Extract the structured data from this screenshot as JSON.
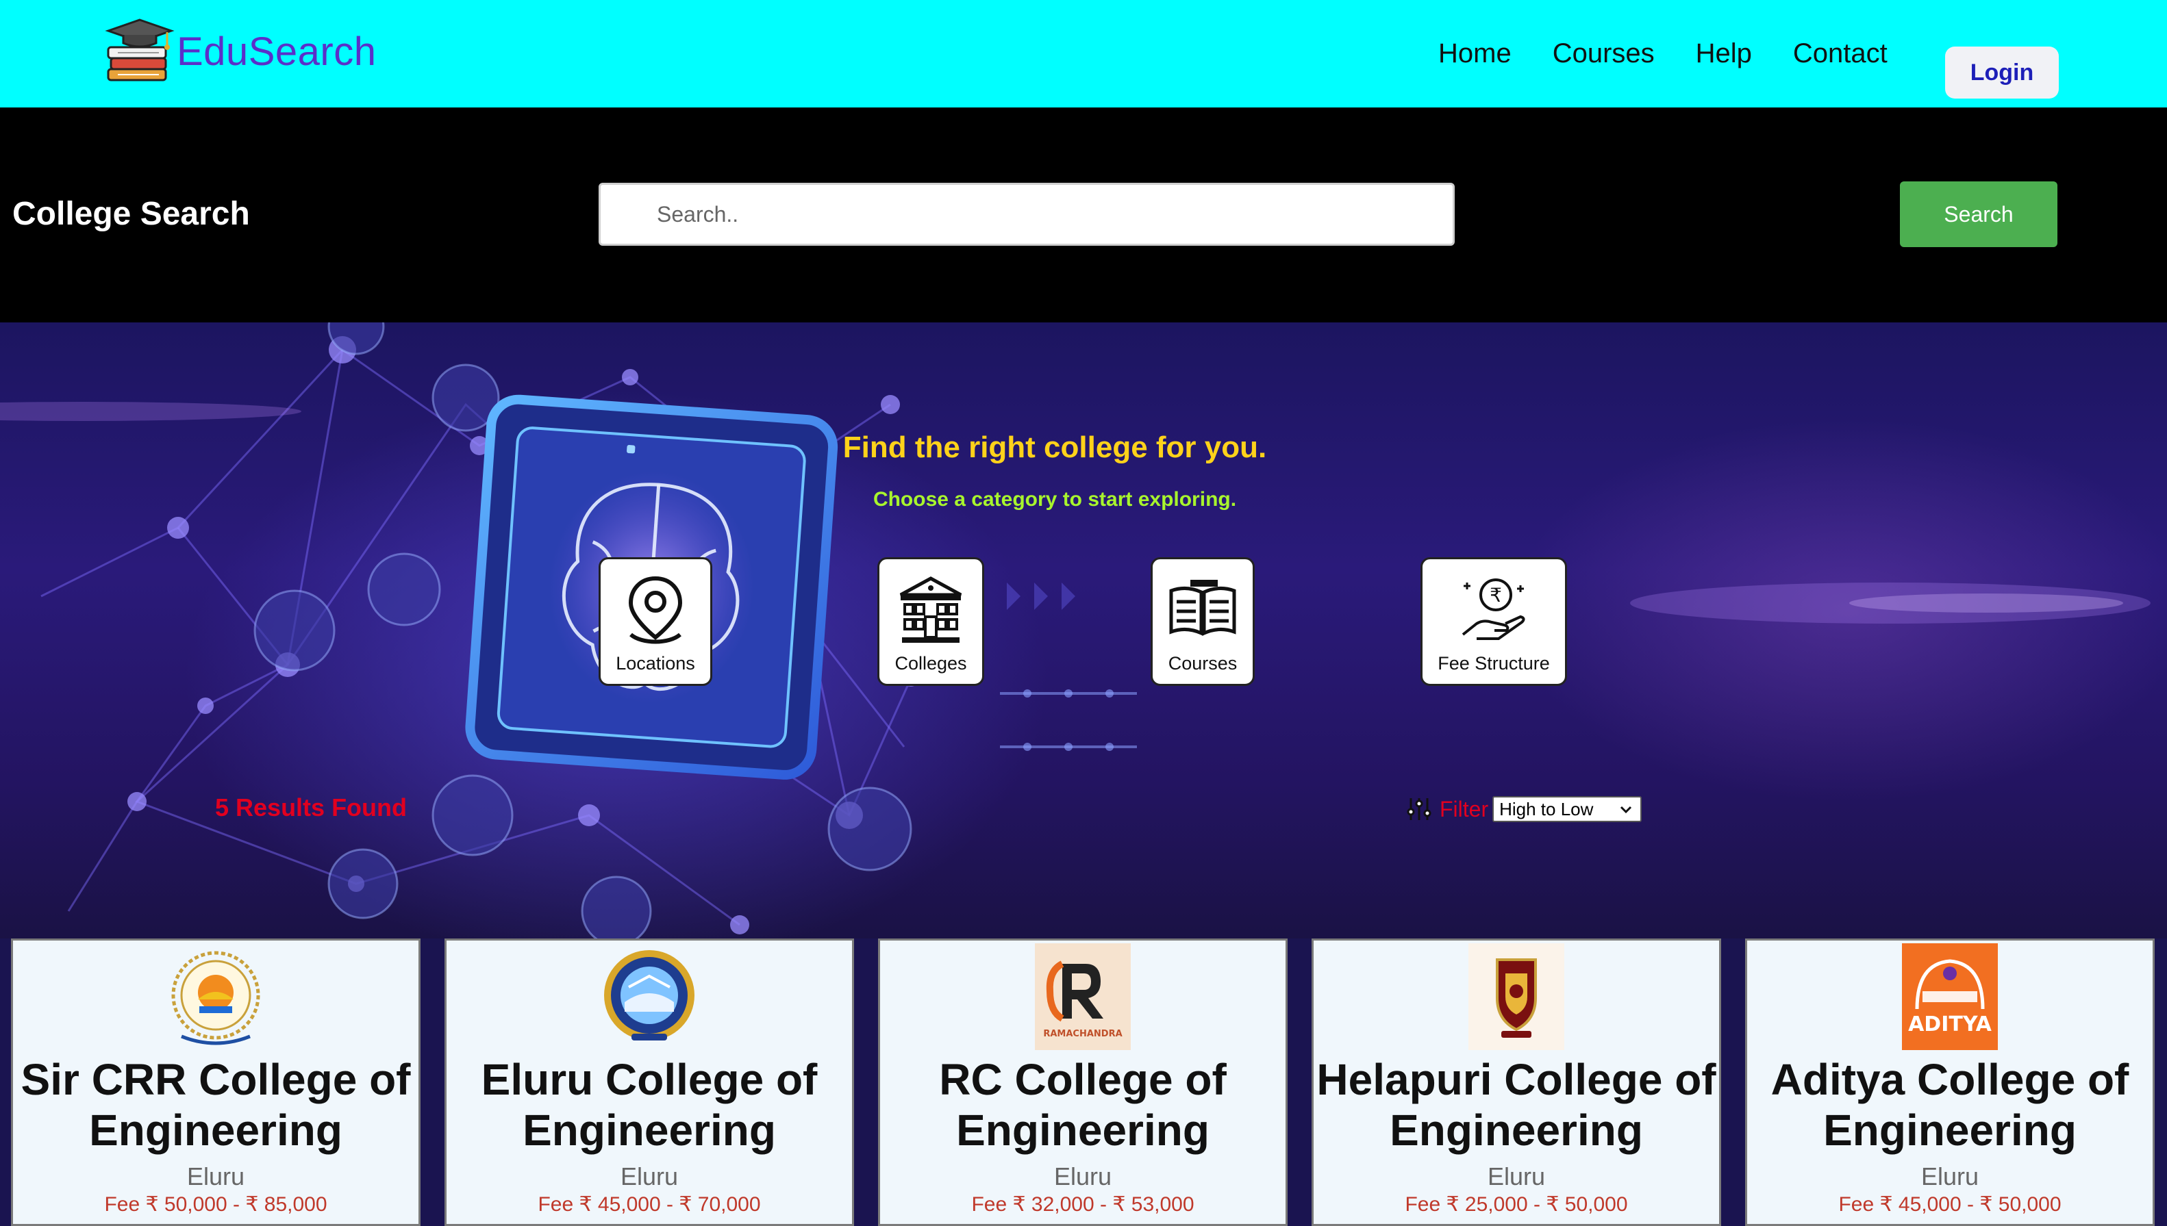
{
  "navbar": {
    "brand": "EduSearch",
    "links": [
      "Home",
      "Courses",
      "Help",
      "Contact"
    ],
    "login": "Login"
  },
  "search": {
    "title": "College Search",
    "placeholder": "Search..",
    "button": "Search"
  },
  "hero": {
    "title": "Find the right college for you.",
    "subtitle": "Choose a category to start exploring.",
    "categories": [
      {
        "label": "Locations",
        "icon": "location-pin-icon"
      },
      {
        "label": "Colleges",
        "icon": "college-building-icon"
      },
      {
        "label": "Courses",
        "icon": "book-icon"
      },
      {
        "label": "Fee Structure",
        "icon": "rupee-hand-icon"
      }
    ]
  },
  "results": {
    "count_text": "5 Results Found",
    "filter_label": "Filter",
    "sort_selected": "High to Low"
  },
  "colors": {
    "navbar": "#00ffff",
    "brand_text": "#5b2fc9",
    "search_button": "#4caf50",
    "hero_title": "#ffd21a",
    "hero_subtitle": "#a8f52d",
    "results_text": "#e1001f"
  },
  "colleges": [
    {
      "name": "Sir CRR College of Engineering",
      "city": "Eluru",
      "fee": "Fee ₹ 50,000 - ₹ 85,000"
    },
    {
      "name": "Eluru College of Engineering",
      "city": "Eluru",
      "fee": "Fee ₹ 45,000 - ₹ 70,000"
    },
    {
      "name": "RC College of Engineering",
      "city": "Eluru",
      "fee": "Fee ₹ 32,000 - ₹ 53,000",
      "logo_text": "RAMACHANDRA"
    },
    {
      "name": "Helapuri College of Engineering",
      "city": "Eluru",
      "fee": "Fee ₹ 25,000 - ₹ 50,000"
    },
    {
      "name": "Aditya College of Engineering",
      "city": "Eluru",
      "fee": "Fee ₹ 45,000 - ₹ 50,000",
      "logo_text": "ADITYA"
    }
  ]
}
